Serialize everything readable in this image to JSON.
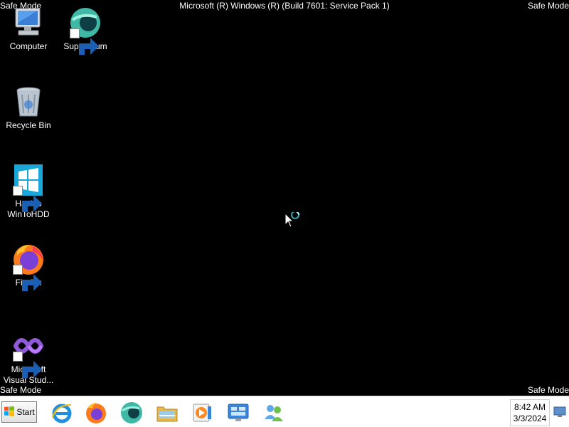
{
  "overlay": {
    "safe_mode": "Safe Mode",
    "os_title": "Microsoft (R) Windows (R) (Build 7601: Service Pack 1)"
  },
  "desktop_icons": [
    {
      "label": "Computer",
      "icon": "computer-icon"
    },
    {
      "label": "Supermium",
      "icon": "supermium-icon"
    },
    {
      "label": "Recycle Bin",
      "icon": "recycle-bin-icon"
    },
    {
      "label": "Hasleo\nWinToHDD",
      "icon": "wintohdd-icon"
    },
    {
      "label": "Firefox",
      "icon": "firefox-icon"
    },
    {
      "label": "Microsoft\nVisual Stud...",
      "icon": "visual-studio-icon"
    }
  ],
  "taskbar": {
    "start_label": "Start",
    "pinned": [
      {
        "name": "internet-explorer",
        "icon": "internet-explorer-icon"
      },
      {
        "name": "firefox",
        "icon": "firefox-icon"
      },
      {
        "name": "supermium",
        "icon": "supermium-icon"
      },
      {
        "name": "file-explorer",
        "icon": "folder-icon"
      },
      {
        "name": "media-player",
        "icon": "media-player-icon"
      },
      {
        "name": "control-panel",
        "icon": "control-panel-icon"
      },
      {
        "name": "network-users",
        "icon": "users-icon"
      }
    ],
    "clock": {
      "time": "8:42 AM",
      "date": "3/3/2024"
    }
  }
}
